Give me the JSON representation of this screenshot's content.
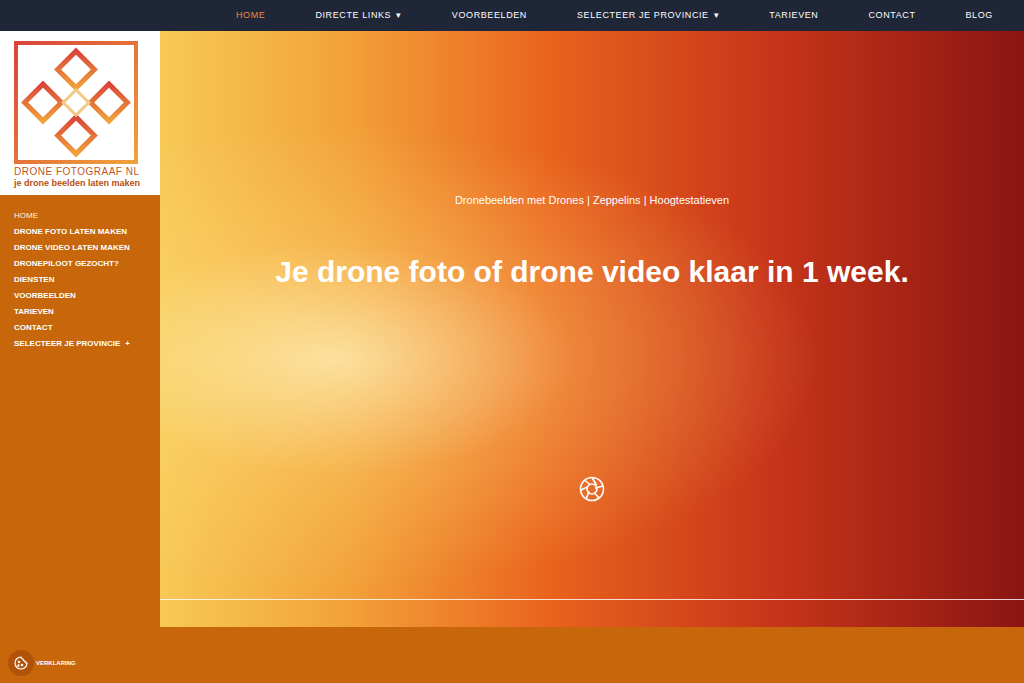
{
  "topnav": {
    "items": [
      {
        "label": "HOME",
        "selected": true,
        "dropdown": false
      },
      {
        "label": "DIRECTE LINKS",
        "selected": false,
        "dropdown": true
      },
      {
        "label": "VOORBEELDEN",
        "selected": false,
        "dropdown": false
      },
      {
        "label": "SELECTEER JE PROVINCIE",
        "selected": false,
        "dropdown": true
      },
      {
        "label": "TARIEVEN",
        "selected": false,
        "dropdown": false
      },
      {
        "label": "CONTACT",
        "selected": false,
        "dropdown": false
      },
      {
        "label": "BLOG",
        "selected": false,
        "dropdown": false
      }
    ],
    "dropdown_glyph": "▾"
  },
  "logo": {
    "title": "DRONE FOTOGRAAF NL",
    "tagline": "je drone beelden laten maken"
  },
  "sidebar": {
    "items": [
      {
        "label": "HOME",
        "selected": true,
        "expandable": false
      },
      {
        "label": "DRONE FOTO LATEN MAKEN",
        "selected": false,
        "expandable": false
      },
      {
        "label": "DRONE VIDEO LATEN MAKEN",
        "selected": false,
        "expandable": false
      },
      {
        "label": "DRONEPILOOT GEZOCHT?",
        "selected": false,
        "expandable": false
      },
      {
        "label": "DIENSTEN",
        "selected": false,
        "expandable": false
      },
      {
        "label": "VOORBEELDEN",
        "selected": false,
        "expandable": false
      },
      {
        "label": "TARIEVEN",
        "selected": false,
        "expandable": false
      },
      {
        "label": "CONTACT",
        "selected": false,
        "expandable": false
      },
      {
        "label": "SELECTEER JE PROVINCIE",
        "selected": false,
        "expandable": true
      }
    ],
    "expand_glyph": "+"
  },
  "hero": {
    "subtitle": "Dronebeelden met Drones | Zeppelins | Hoogtestatieven",
    "heading": "Je drone foto of drone video klaar in 1 week."
  },
  "footer": {
    "cookie_link": "VERKLARING"
  }
}
